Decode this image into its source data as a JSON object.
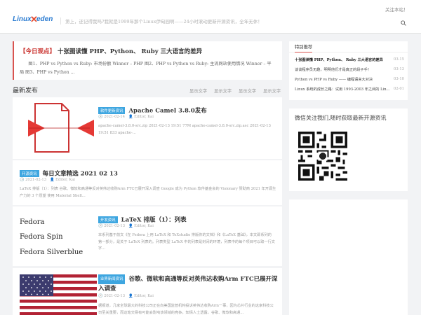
{
  "header": {
    "logo_left": "Linux",
    "logo_right": "eden",
    "logo_x": "✕",
    "tagline": "第上，还记得我吗?我就是1999年那个Linux伊甸园啊——24小时滚动更新开源资讯，全年无休！",
    "follow": "关注本站！"
  },
  "viewpoint": {
    "label": "【今日观点】",
    "title": "十张图读懂 PHP、Python、 Ruby 三大语言的差异",
    "text": "图1、PHP vs Python vs Ruby: 市场份额 Winner – PHP 图2、PHP vs Python vs Ruby: 主流网站使用情况 Winner – 平局 图3、PHP vs Python ..."
  },
  "latest": {
    "heading": "最新发布",
    "links": [
      "显示文字",
      "显示文字",
      "显示文字",
      "显示文字"
    ]
  },
  "posts": [
    {
      "tag": "软件更新资讯",
      "title": "Apache Camel 3.8.0发布",
      "date": "2021-02-14",
      "author": "Editor, Kai",
      "excerpt": "apache-camel-3.8.0-src.zip 2021-02-13 19:51 77M apache-camel-3.8.0-src.zip.asc 2021-02-13 19:51 833 apache-..."
    },
    {
      "tag": "开源资讯",
      "title": "每日文章精选 2021 02 13",
      "date": "2021-02-13",
      "author": "Editor, Kai",
      "excerpt": "LaTeX 排版（1）：列表 谷歌、微软和高通等反对英伟达收购Arm FTC已展开深入调查 Google 成为 Python 软件基金会的 Visionary 赞助商 2021 年开源生产力的 3 个愿望 使用 Material Shell..."
    },
    {
      "tag": "开发资讯",
      "title": "LaTeX 排版（1）：列表",
      "date": "2021-02-13",
      "author": "Editor, Kai",
      "thumb_lines": [
        "Fedora",
        "Fedora Spin",
        "Fedora Silverblue"
      ],
      "excerpt": "本系列基于前文《在 Fedora 上用 LaTeX 和 TeXstudio 排版你的文档》和《LaTeX 基础》，本文即系列的第一部分，是关于 LaTeX 列表的。列表类型 LaTeX 中的列表是封闭的环境，列表中的每个项目可以取一行文字..."
    },
    {
      "tag": "业界新闻资讯",
      "title": "谷歌、微软和高通等反对英伟达收购Arm FTC已展开深入调查",
      "date": "2021-02-13",
      "author": "Editor, Kai",
      "excerpt": "据报道，几家全球最大的科技公司正在向美国监管机构投诉英伟达收购Arm一事，因为芯片行业的这家科技公司至关重要，而这笔交易有可能会影响该领域的竞争。知情人士透露，谷歌、微软和高通..."
    }
  ],
  "sidebar": {
    "recommend_title": "特别推荐",
    "recommend": [
      {
        "title": "十张图读懂 PHP、Python、 Ruby 三大语言的差异",
        "date": "03-15"
      },
      {
        "title": "谈谈程序员无趣，明明他们才是真正的段子手！",
        "date": "03-13"
      },
      {
        "title": "Python vs PHP vs Ruby —— 编程语言大对决",
        "date": "03-10"
      },
      {
        "title": "Linux 系统的成长之路：试用 1993-2003 年之间的 Lin...",
        "date": "02-01"
      }
    ],
    "wechat_title": "微信关注我们,随时获取最新开源资讯"
  }
}
